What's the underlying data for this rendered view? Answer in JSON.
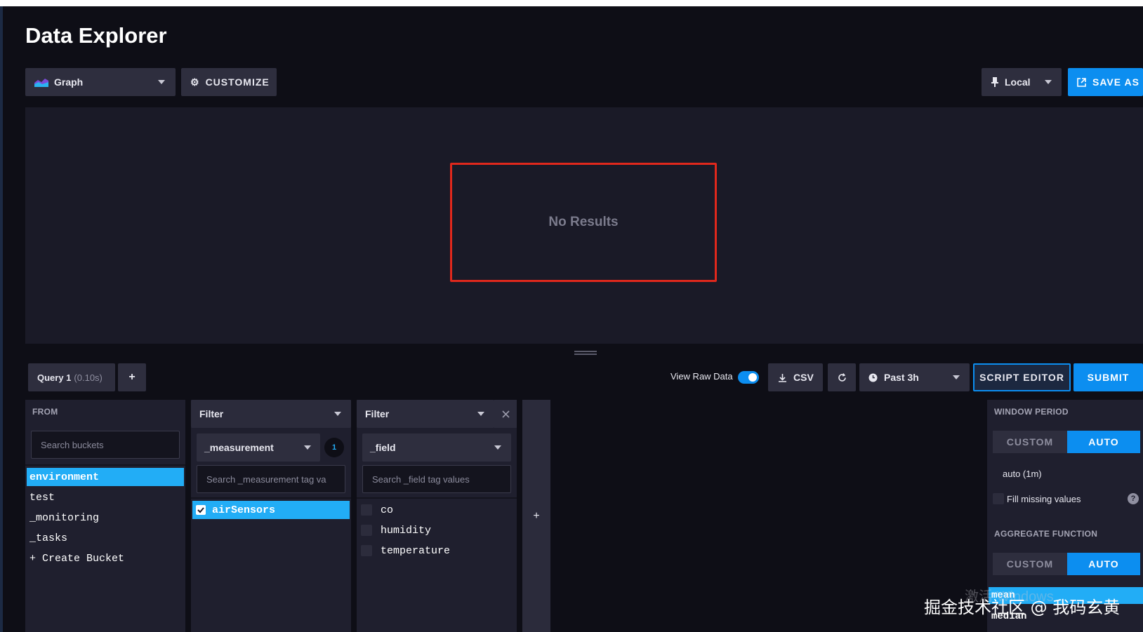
{
  "header": {
    "title": "Data Explorer"
  },
  "toolbar": {
    "view_type": "Graph",
    "customize_label": "CUSTOMIZE",
    "timezone": "Local",
    "save_as_label": "SAVE AS"
  },
  "graph": {
    "empty_message": "No Results"
  },
  "query_bar": {
    "tab_label": "Query 1",
    "tab_timing": "(0.10s)",
    "add_label": "+",
    "view_raw_label": "View Raw Data",
    "view_raw_enabled": true,
    "csv_label": "CSV",
    "time_range": "Past 3h",
    "script_editor_label": "SCRIPT EDITOR",
    "submit_label": "SUBMIT"
  },
  "from_panel": {
    "header": "FROM",
    "search_placeholder": "Search buckets",
    "buckets": [
      "environment",
      "test",
      "_monitoring",
      "_tasks"
    ],
    "selected_bucket": "environment",
    "create_label": "+ Create Bucket"
  },
  "filter1": {
    "header": "Filter",
    "key": "_measurement",
    "count": "1",
    "search_placeholder": "Search _measurement tag va",
    "values": [
      {
        "label": "airSensors",
        "checked": true
      }
    ]
  },
  "filter2": {
    "header": "Filter",
    "key": "_field",
    "search_placeholder": "Search _field tag values",
    "values": [
      {
        "label": "co",
        "checked": false
      },
      {
        "label": "humidity",
        "checked": false
      },
      {
        "label": "temperature",
        "checked": false
      }
    ]
  },
  "add_filter_label": "+",
  "aggregate_panel": {
    "window_period_label": "WINDOW PERIOD",
    "custom_label": "CUSTOM",
    "auto_label": "AUTO",
    "window_value": "auto (1m)",
    "fill_missing_label": "Fill missing values",
    "help_label": "?",
    "aggregate_label": "AGGREGATE FUNCTION",
    "functions": [
      "mean",
      "median"
    ],
    "selected_function": "mean"
  },
  "overlay": {
    "activate_windows": "激活 Windows",
    "watermark": "掘金技术社区 @ 我码玄黄"
  },
  "colors": {
    "accent": "#0c8ef0",
    "selection": "#22adf6",
    "highlight": "#e0281c"
  }
}
